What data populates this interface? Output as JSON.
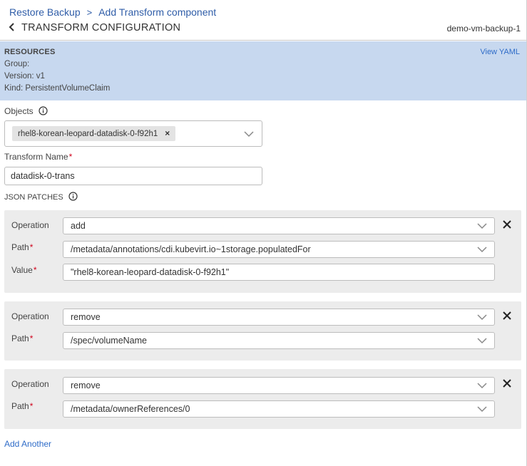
{
  "breadcrumb": {
    "parent": "Restore Backup",
    "separator": ">",
    "current": "Add Transform component"
  },
  "header": {
    "title": "TRANSFORM CONFIGURATION",
    "backup_name": "demo-vm-backup-1"
  },
  "resources": {
    "title": "RESOURCES",
    "group": "Group:",
    "version": "Version: v1",
    "kind": "Kind: PersistentVolumeClaim",
    "view_yaml": "View YAML"
  },
  "objects": {
    "label": "Objects",
    "chip": "rhel8-korean-leopard-datadisk-0-f92h1"
  },
  "transform_name": {
    "label": "Transform Name",
    "value": "datadisk-0-trans"
  },
  "json_patches": {
    "label": "JSON PATCHES",
    "operation_label": "Operation",
    "path_label": "Path",
    "value_label": "Value",
    "patches": [
      {
        "operation": "add",
        "path": "/metadata/annotations/cdi.kubevirt.io~1storage.populatedFor",
        "value": "\"rhel8-korean-leopard-datadisk-0-f92h1\""
      },
      {
        "operation": "remove",
        "path": "/spec/volumeName"
      },
      {
        "operation": "remove",
        "path": "/metadata/ownerReferences/0"
      }
    ]
  },
  "add_another": "Add Another",
  "colors": {
    "accent": "#2f5da8",
    "link": "#2f6cc8",
    "resources_bg": "#c7d8ef",
    "panel_bg": "#ececec",
    "required": "#d0021b"
  }
}
